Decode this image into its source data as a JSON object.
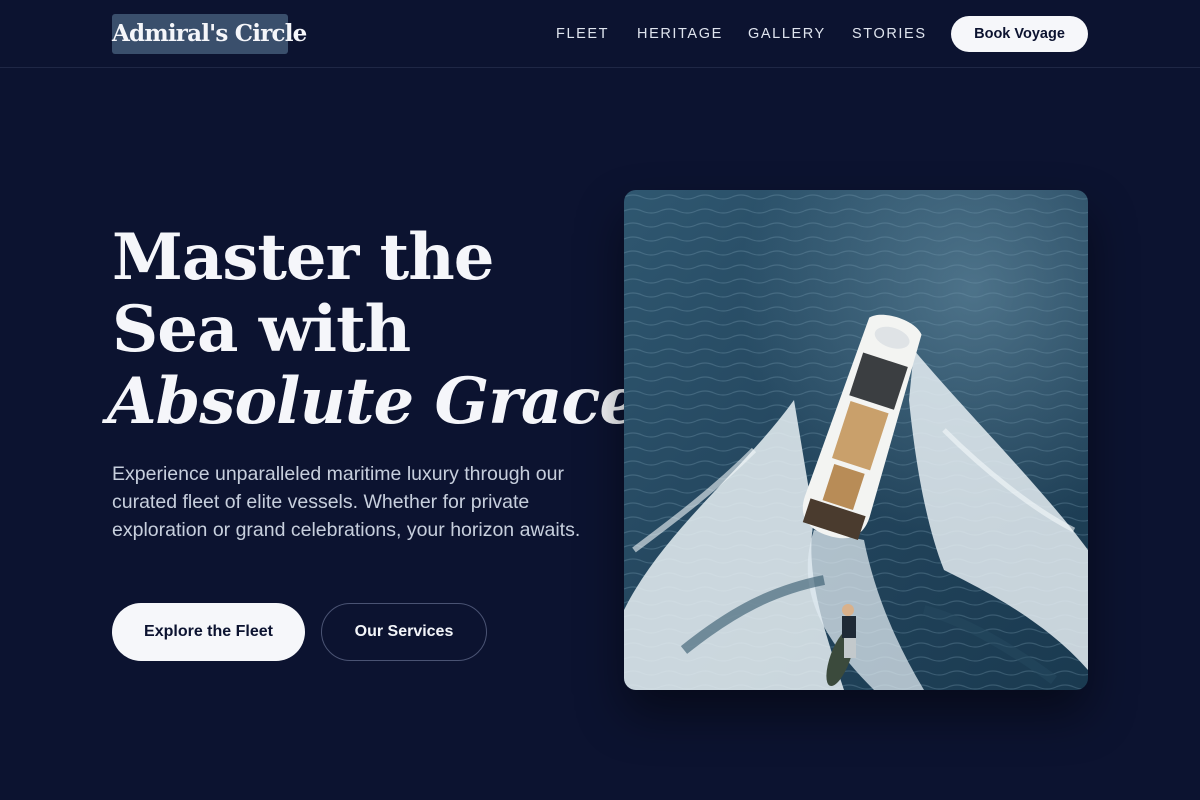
{
  "header": {
    "logo_text": "Admiral's Circle",
    "nav": [
      "FLEET",
      "HERITAGE",
      "GALLERY",
      "STORIES"
    ],
    "cta_label": "Book Voyage"
  },
  "hero": {
    "title_line1": "Master the",
    "title_line2": "Sea with",
    "title_line3": "Absolute Grace",
    "description": "Experience unparalleled maritime luxury through our curated fleet of elite vessels. Whether for private exploration or grand celebrations, your horizon awaits.",
    "primary_button": "Explore the Fleet",
    "secondary_button": "Our Services"
  },
  "colors": {
    "background": "#0c1330",
    "logo_bg": "#3a4f6c",
    "button_light": "#f6f7fa",
    "text_muted": "#c7cfdd",
    "water": "#24465e"
  }
}
